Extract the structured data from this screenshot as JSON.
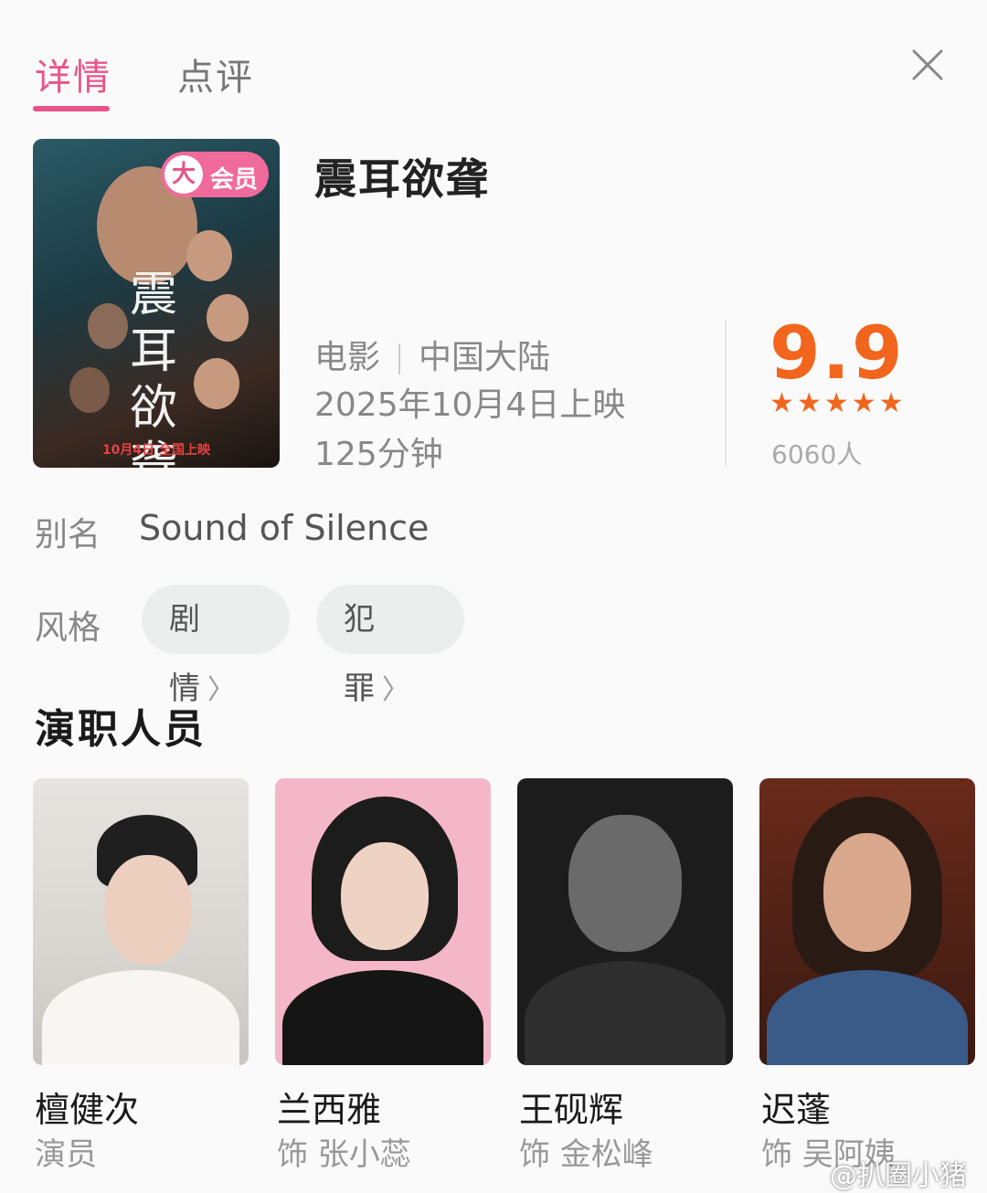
{
  "tabs": {
    "detail": "详情",
    "review": "点评"
  },
  "poster": {
    "vip_char": "大",
    "vip_text": "会员",
    "title_art": "震耳欲聋",
    "release_line": "10月4日 全国上映"
  },
  "movie": {
    "title": "震耳欲聋",
    "type": "电影",
    "region": "中国大陆",
    "release": "2025年10月4日上映",
    "duration": "125分钟",
    "score": "9.9",
    "stars": "★★★★★",
    "rating_count": "6060人",
    "alias_label": "别名",
    "alias": "Sound of Silence",
    "genre_label": "风格",
    "genres": [
      "剧情",
      "犯罪"
    ]
  },
  "cast_section": {
    "title": "演职人员",
    "members": [
      {
        "name": "檀健次",
        "role": "演员"
      },
      {
        "name": "兰西雅",
        "role": "饰 张小蕊"
      },
      {
        "name": "王砚辉",
        "role": "饰 金松峰"
      },
      {
        "name": "迟蓬",
        "role": "饰 吴阿姨"
      }
    ]
  },
  "watermark": "@扒圈小猪",
  "colors": {
    "accent_pink": "#e8548a",
    "score_orange": "#f2651d"
  }
}
